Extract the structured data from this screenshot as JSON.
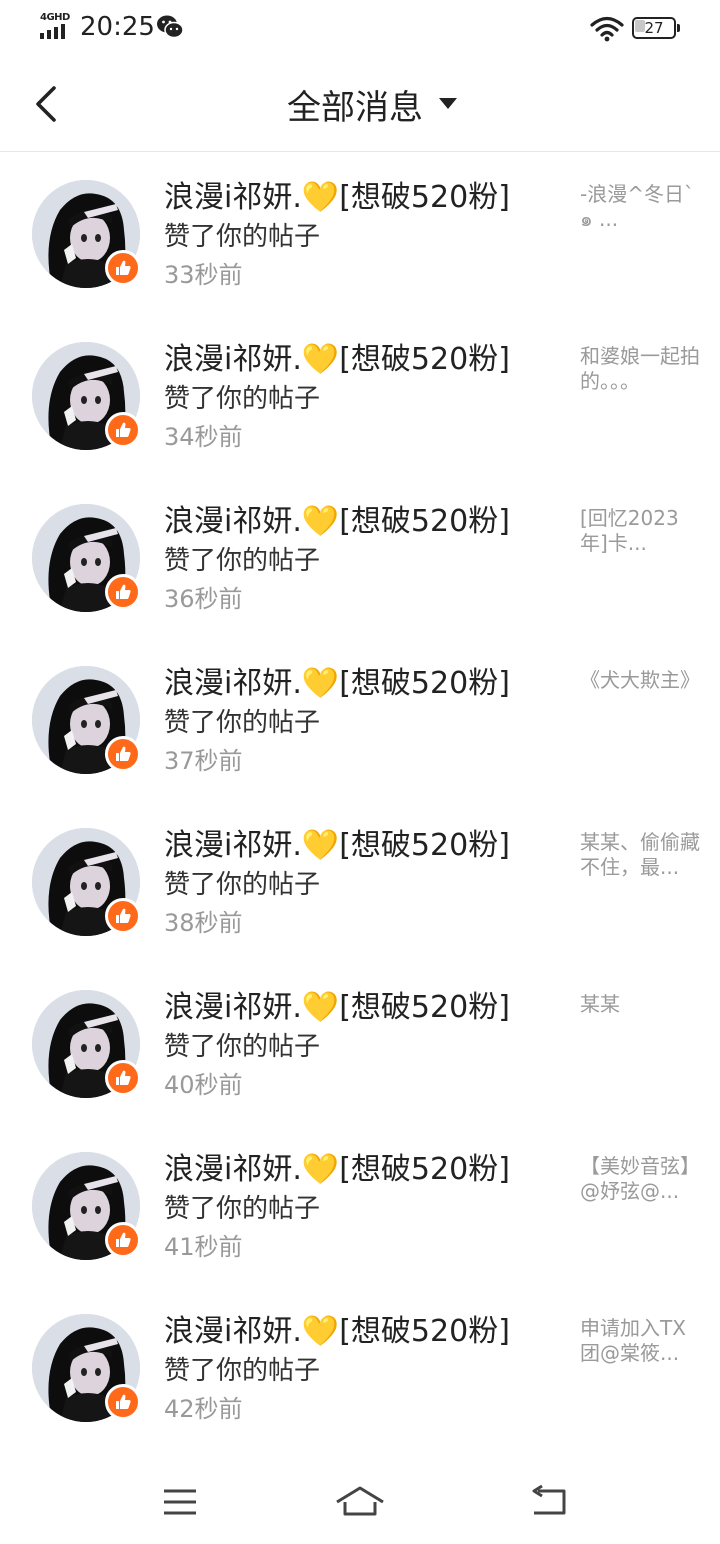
{
  "status_bar": {
    "network": "4GHD",
    "time": "20:25",
    "battery_level": "27",
    "battery_fraction": 0.27
  },
  "header": {
    "title": "全部消息"
  },
  "messages": [
    {
      "user": "浪漫i祁妍.💛[想破520粉]",
      "action": "赞了你的帖子",
      "time": "33秒前",
      "preview": "-浪漫^冬日`๑ ..."
    },
    {
      "user": "浪漫i祁妍.💛[想破520粉]",
      "action": "赞了你的帖子",
      "time": "34秒前",
      "preview": "和婆娘一起拍的。。。"
    },
    {
      "user": "浪漫i祁妍.💛[想破520粉]",
      "action": "赞了你的帖子",
      "time": "36秒前",
      "preview": "[回忆2023年]卡..."
    },
    {
      "user": "浪漫i祁妍.💛[想破520粉]",
      "action": "赞了你的帖子",
      "time": "37秒前",
      "preview": "《犬大欺主》"
    },
    {
      "user": "浪漫i祁妍.💛[想破520粉]",
      "action": "赞了你的帖子",
      "time": "38秒前",
      "preview": "某某、偷偷藏不住，最..."
    },
    {
      "user": "浪漫i祁妍.💛[想破520粉]",
      "action": "赞了你的帖子",
      "time": "40秒前",
      "preview": "某某"
    },
    {
      "user": "浪漫i祁妍.💛[想破520粉]",
      "action": "赞了你的帖子",
      "time": "41秒前",
      "preview": "【美妙音弦】@妤弦@..."
    },
    {
      "user": "浪漫i祁妍.💛[想破520粉]",
      "action": "赞了你的帖子",
      "time": "42秒前",
      "preview": "申请加入TX团@棠筱..."
    }
  ],
  "icons": {
    "back": "chevron-left-icon",
    "dropdown": "caret-down-icon",
    "like": "thumbs-up-icon",
    "menu": "menu-icon",
    "home": "home-icon",
    "back_nav": "return-icon"
  },
  "colors": {
    "like_badge": "#ff6a1a",
    "time_text": "#999999",
    "preview_text": "#9a9a9a"
  }
}
